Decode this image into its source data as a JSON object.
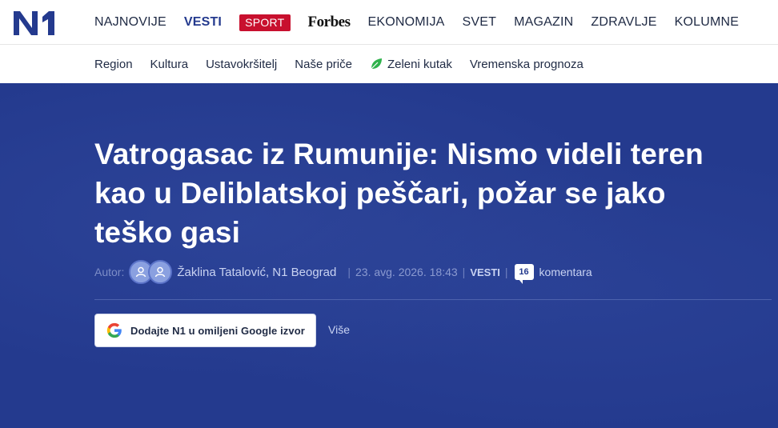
{
  "site": {
    "logo_text": "N1"
  },
  "topnav": {
    "items": [
      "NAJNOVIJE",
      "VESTI"
    ],
    "sport_label": "SPORT",
    "forbes_label": "Forbes",
    "items_after": [
      "EKONOMIJA",
      "SVET",
      "MAGAZIN",
      "ZDRAVLJE",
      "KOLUMNE"
    ]
  },
  "subnav": {
    "items": [
      "Region",
      "Kultura",
      "Ustavokršitelj",
      "Naše priče"
    ],
    "green_item": "Zeleni kutak",
    "weather_item": "Vremenska prognoza"
  },
  "article": {
    "headline": "Vatrogasac iz Rumunije: Nismo videli teren kao u Deliblatskoj peščari, požar se jako teško gasi",
    "autor_label": "Autor:",
    "author": "Žaklina Tatalović, N1 Beograd",
    "date": "23. avg. 2026. 18:43",
    "category": "VESTI",
    "comments_count": "16",
    "comments_label": "komentara"
  },
  "google_source": {
    "label": "Dodajte N1 u omiljeni Google izvor",
    "more_label": "Više"
  },
  "colors": {
    "brand_blue": "#243a8e",
    "sport_red": "#c8102e",
    "green_leaf": "#2fb24c"
  }
}
